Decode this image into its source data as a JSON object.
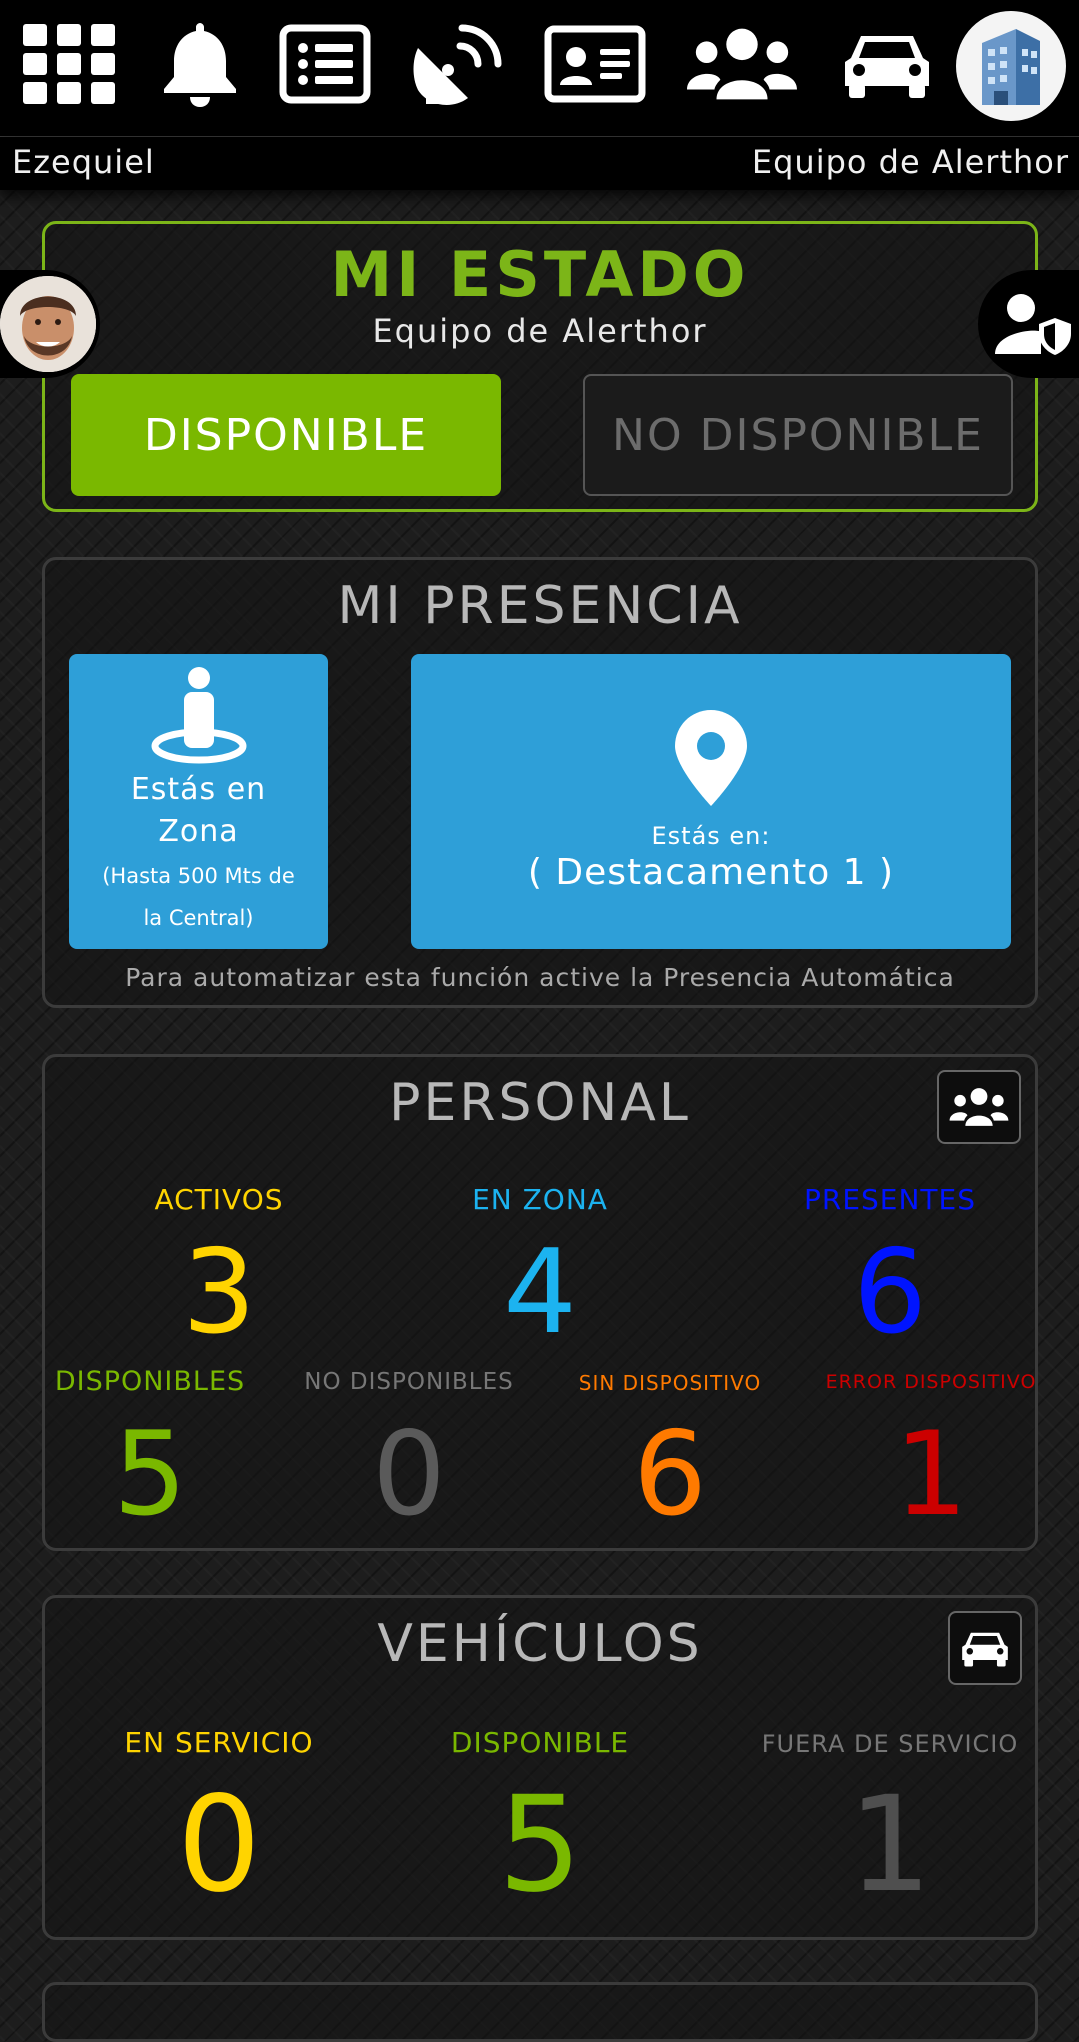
{
  "header": {
    "nav": [
      {
        "icon": "apps-grid-icon"
      },
      {
        "icon": "bell-icon"
      },
      {
        "icon": "list-icon"
      },
      {
        "icon": "satellite-dish-icon"
      },
      {
        "icon": "id-card-icon"
      },
      {
        "icon": "users-icon"
      },
      {
        "icon": "car-icon"
      }
    ],
    "org_avatar_icon": "building-icon",
    "user_name": "Ezequiel",
    "team_name": "Equipo de Alerthor"
  },
  "estado": {
    "title": "MI ESTADO",
    "subtitle": "Equipo de Alerthor",
    "disponible_label": "DISPONIBLE",
    "no_disponible_label": "NO DISPONIBLE",
    "user_avatar_icon": "user-photo",
    "shield_icon": "user-shield-icon"
  },
  "presencia": {
    "title": "MI PRESENCIA",
    "zona_line1": "Estás en",
    "zona_line2": "Zona",
    "zona_detail1": "(Hasta 500 Mts de",
    "zona_detail2": "la Central)",
    "dest_label": "Estás en:",
    "dest_value": "( Destacamento 1 )",
    "footer": "Para automatizar esta función active la Presencia Automática"
  },
  "personal": {
    "title": "PERSONAL",
    "activos_label": "ACTIVOS",
    "activos": "3",
    "en_zona_label": "EN ZONA",
    "en_zona": "4",
    "presentes_label": "PRESENTES",
    "presentes": "6",
    "disponibles_label": "DISPONIBLES",
    "disponibles": "5",
    "no_disponibles_label": "NO DISPONIBLES",
    "no_disponibles": "0",
    "sin_dispositivo_label": "SIN DISPOSITIVO",
    "sin_dispositivo": "6",
    "error_dispositivo_label": "ERROR DISPOSITIVO",
    "error_dispositivo": "1"
  },
  "vehiculos": {
    "title": "VEHÍCULOS",
    "en_servicio_label": "EN SERVICIO",
    "en_servicio": "0",
    "disponible_label": "DISPONIBLE",
    "disponible": "5",
    "fuera_servicio_label": "FUERA DE SERVICIO",
    "fuera_servicio": "1"
  },
  "colors": {
    "green": "#7ab800",
    "yellow": "#ffd400",
    "cyan": "#1cb3f0",
    "blue": "#0014ff",
    "orange": "#ff7a00",
    "red": "#cc0000",
    "gray": "#777777",
    "tile_blue": "#2e9fd8"
  }
}
